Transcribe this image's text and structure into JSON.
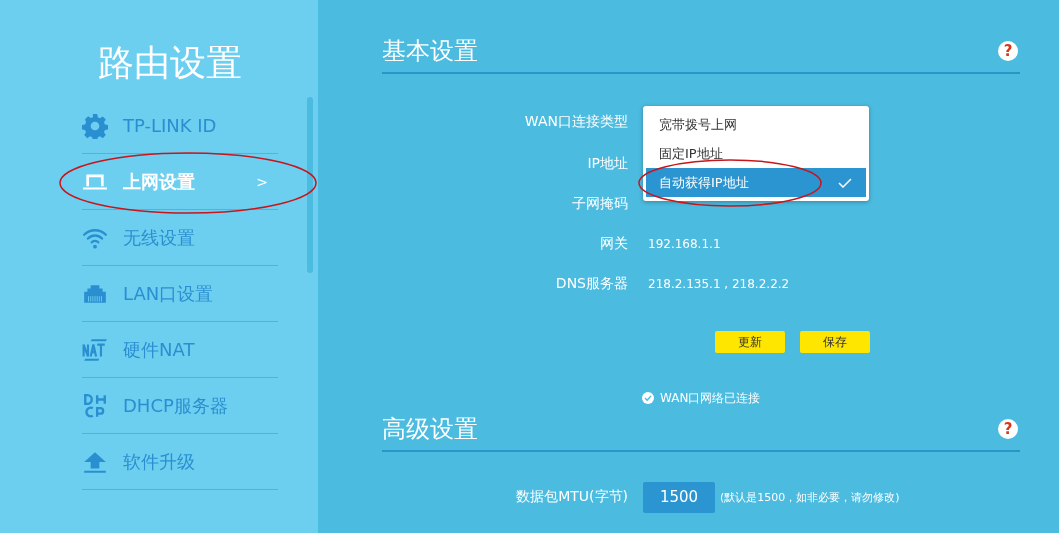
{
  "sidebar": {
    "title": "路由设置",
    "items": [
      {
        "label": "TP-LINK ID",
        "kind": "gear",
        "selected": false
      },
      {
        "label": "上网设置",
        "kind": "laptop",
        "selected": true,
        "chevron": ">"
      },
      {
        "label": "无线设置",
        "kind": "wifi",
        "selected": false
      },
      {
        "label": "LAN口设置",
        "kind": "lan",
        "selected": false
      },
      {
        "label": "硬件NAT",
        "kind": "nat",
        "selected": false
      },
      {
        "label": "DHCP服务器",
        "kind": "dhcp",
        "selected": false
      },
      {
        "label": "软件升级",
        "kind": "upload",
        "selected": false
      }
    ]
  },
  "basic": {
    "title": "基本设置",
    "help": "?",
    "fields": [
      {
        "label": "WAN口连接类型",
        "kind": "select"
      },
      {
        "label": "IP地址",
        "kind": "hidden"
      },
      {
        "label": "子网掩码",
        "kind": "hidden"
      },
      {
        "label": "网关",
        "kind": "text",
        "value": "192.168.1.1"
      },
      {
        "label": "DNS服务器",
        "kind": "text",
        "value": "218.2.135.1 , 218.2.2.2"
      }
    ],
    "dropdown": [
      {
        "label": "宽带拨号上网",
        "selected": false
      },
      {
        "label": "固定IP地址",
        "selected": false
      },
      {
        "label": "自动获得IP地址",
        "selected": true
      }
    ],
    "buttons": [
      "更新",
      "保存"
    ],
    "status": "WAN口网络已连接"
  },
  "advanced": {
    "title": "高级设置",
    "help": "?",
    "mtu": {
      "label": "数据包MTU(字节)",
      "value": "1500",
      "hint": "(默认是1500，如非必要，请勿修改)"
    }
  }
}
